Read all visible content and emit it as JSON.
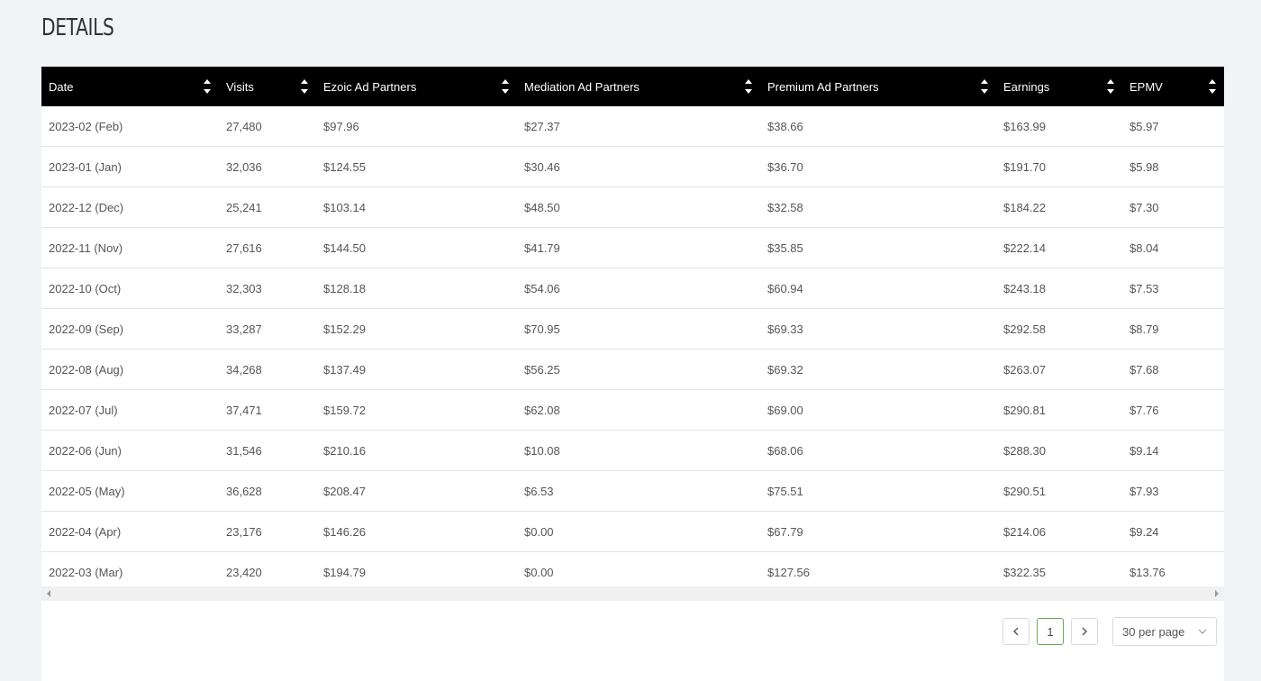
{
  "page": {
    "title": "DETAILS"
  },
  "table": {
    "columns": [
      "Date",
      "Visits",
      "Ezoic Ad Partners",
      "Mediation Ad Partners",
      "Premium Ad Partners",
      "Earnings",
      "EPMV"
    ],
    "rows": [
      [
        "2023-02 (Feb)",
        "27,480",
        "$97.96",
        "$27.37",
        "$38.66",
        "$163.99",
        "$5.97"
      ],
      [
        "2023-01 (Jan)",
        "32,036",
        "$124.55",
        "$30.46",
        "$36.70",
        "$191.70",
        "$5.98"
      ],
      [
        "2022-12 (Dec)",
        "25,241",
        "$103.14",
        "$48.50",
        "$32.58",
        "$184.22",
        "$7.30"
      ],
      [
        "2022-11 (Nov)",
        "27,616",
        "$144.50",
        "$41.79",
        "$35.85",
        "$222.14",
        "$8.04"
      ],
      [
        "2022-10 (Oct)",
        "32,303",
        "$128.18",
        "$54.06",
        "$60.94",
        "$243.18",
        "$7.53"
      ],
      [
        "2022-09 (Sep)",
        "33,287",
        "$152.29",
        "$70.95",
        "$69.33",
        "$292.58",
        "$8.79"
      ],
      [
        "2022-08 (Aug)",
        "34,268",
        "$137.49",
        "$56.25",
        "$69.32",
        "$263.07",
        "$7.68"
      ],
      [
        "2022-07 (Jul)",
        "37,471",
        "$159.72",
        "$62.08",
        "$69.00",
        "$290.81",
        "$7.76"
      ],
      [
        "2022-06 (Jun)",
        "31,546",
        "$210.16",
        "$10.08",
        "$68.06",
        "$288.30",
        "$9.14"
      ],
      [
        "2022-05 (May)",
        "36,628",
        "$208.47",
        "$6.53",
        "$75.51",
        "$290.51",
        "$7.93"
      ],
      [
        "2022-04 (Apr)",
        "23,176",
        "$146.26",
        "$0.00",
        "$67.79",
        "$214.06",
        "$9.24"
      ],
      [
        "2022-03 (Mar)",
        "23,420",
        "$194.79",
        "$0.00",
        "$127.56",
        "$322.35",
        "$13.76"
      ]
    ]
  },
  "pagination": {
    "current_page": "1",
    "per_page_label": "30 per page"
  },
  "icons": {
    "sort": "sort-icon",
    "prev": "chevron-left-icon",
    "next": "chevron-right-icon",
    "dropdown": "chevron-down-icon"
  },
  "colors": {
    "header_bg": "#000000",
    "active_page_border": "#6aa84f",
    "background": "#f2f3f5"
  }
}
